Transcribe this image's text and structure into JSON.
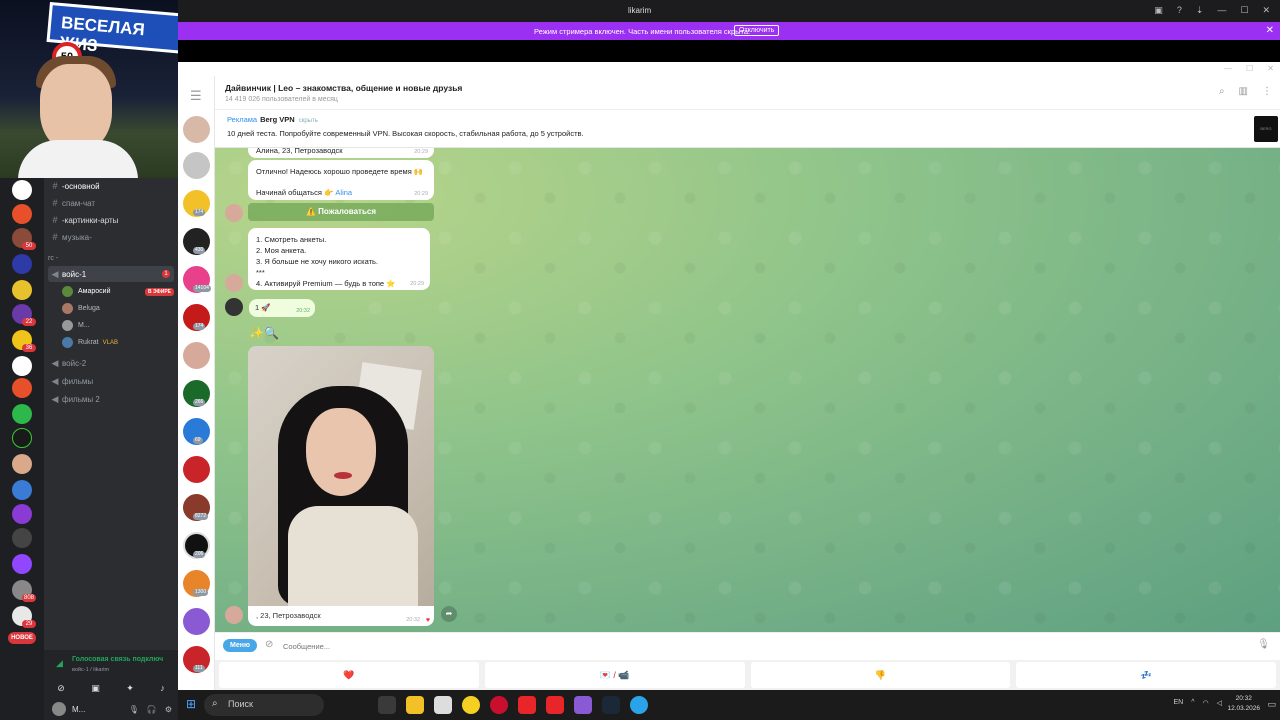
{
  "webcam": {
    "sign_text": "ВЕСЕЛАЯ ЖИЗ",
    "road_sign": "50"
  },
  "discord": {
    "server_badges": [
      "50",
      "22",
      "36",
      "808",
      "29"
    ],
    "new_badge": "НОВОЕ",
    "channels": [
      {
        "name": "-основной",
        "type": "text"
      },
      {
        "name": "спам-чат",
        "type": "text"
      },
      {
        "name": "-картинки-арты",
        "type": "text"
      },
      {
        "name": "музыка-",
        "type": "text"
      }
    ],
    "category": "гс -",
    "voice_active": {
      "name": "войс-1",
      "unread": "1"
    },
    "voice_users": [
      {
        "name": "Амаросий",
        "live": "В ЭФИРЕ"
      },
      {
        "name": "Beluga"
      },
      {
        "name": "М..."
      },
      {
        "name": "Rukrat",
        "tag": "VLAB"
      }
    ],
    "voice_channels": [
      "войс-2",
      "фильмы",
      "фильмы 2"
    ],
    "voice_status": "Голосовая связь подключ",
    "voice_sub": "войс-1 / likarim",
    "user_name": "М..."
  },
  "window": {
    "title": "likarim"
  },
  "streamer": {
    "message": "Режим стримера включен. Часть имени пользователя скрыта.",
    "button": "Отключить"
  },
  "telegram": {
    "chat_name": "Дайвинчик | Leo – знакомства, общение и новые друзья",
    "chat_sub": "14 419 026 пользователей в месяц",
    "chat_counts": [
      "174",
      "430",
      "14104",
      "174",
      "266",
      "69",
      "8272",
      "206",
      "1300",
      "111"
    ],
    "ad": {
      "label": "Реклама",
      "brand": "Berg VPN",
      "hide": "скрыть",
      "text": "10 дней теста. Попробуйте современный VPN. Высокая скорость, стабильная работа, до 5 устройств."
    },
    "messages": {
      "m0": "Алина, 23, Петрозаводск",
      "m0_time": "20:29",
      "m1_line1": "Отлично! Надеюсь хорошо проведете время 🙌",
      "m1_line2": "Начинай общаться 👉",
      "m1_link": "Alina",
      "m1_time": "20:29",
      "report_btn": "⚠️ Пожаловаться",
      "menu_lines": [
        "1. Смотреть анкеты.",
        "2. Моя анкета.",
        "3. Я больше не хочу никого искать.",
        "***",
        "4. Активируй Premium — будь в топе ⭐"
      ],
      "menu_time": "20:29",
      "out_text": "1 🚀",
      "out_time": "20:32",
      "emoji": "✨🔍",
      "caption": ", 23, Петрозаводск",
      "caption_time": "20:32"
    },
    "input": {
      "menu_button": "Меню",
      "placeholder": "Сообщение..."
    },
    "keyboard": [
      "❤️",
      "💌 / 📹",
      "👎",
      "💤"
    ]
  },
  "taskbar": {
    "search": "Поиск",
    "lang": "EN",
    "time": "20:32",
    "date": "12.03.2026"
  }
}
